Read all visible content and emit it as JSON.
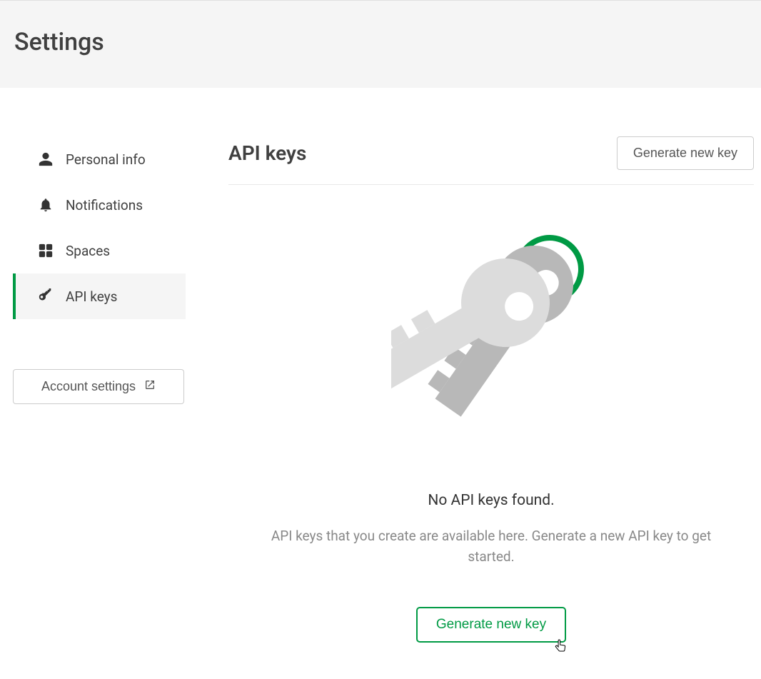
{
  "page": {
    "title": "Settings"
  },
  "sidebar": {
    "items": [
      {
        "label": "Personal info",
        "active": false
      },
      {
        "label": "Notifications",
        "active": false
      },
      {
        "label": "Spaces",
        "active": false
      },
      {
        "label": "API keys",
        "active": true
      }
    ],
    "account_settings_label": "Account settings"
  },
  "main": {
    "heading": "API keys",
    "generate_button_top": "Generate new key",
    "empty": {
      "title": "No API keys found.",
      "description": "API keys that you create are available here. Generate a new API key to get started.",
      "generate_button": "Generate new key"
    }
  },
  "colors": {
    "accent": "#009a44"
  }
}
